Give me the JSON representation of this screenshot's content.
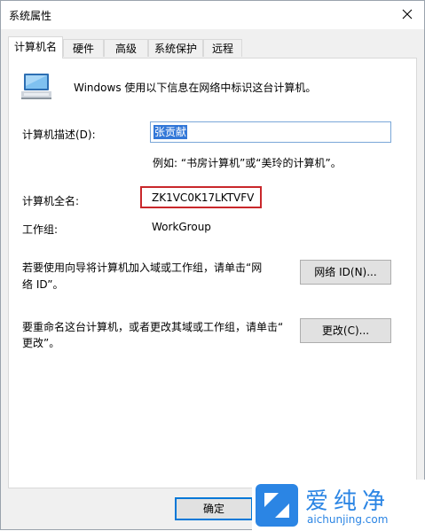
{
  "window": {
    "title": "系统属性"
  },
  "tabs": [
    {
      "label": "计算机名",
      "active": true
    },
    {
      "label": "硬件",
      "active": false
    },
    {
      "label": "高级",
      "active": false
    },
    {
      "label": "系统保护",
      "active": false
    },
    {
      "label": "远程",
      "active": false
    }
  ],
  "main": {
    "info_text": "Windows 使用以下信息在网络中标识这台计算机。",
    "description": {
      "label": "计算机描述(D):",
      "value": "张贡献",
      "hint": "例如: “书房计算机”或“美玲的计算机”。"
    },
    "full_name": {
      "label": "计算机全名:",
      "value": "ZK1VC0K17LKTVFV"
    },
    "workgroup": {
      "label": "工作组:",
      "value": "WorkGroup"
    },
    "network_id": {
      "text_line1": "若要使用向导将计算机加入域或工作组，请单击“网",
      "text_line2": "络 ID”。",
      "button": "网络 ID(N)..."
    },
    "rename": {
      "text_line1": "要重命名这台计算机，或者更改其域或工作组，请单击“",
      "text_line2": "更改”。",
      "button": "更改(C)..."
    }
  },
  "footer": {
    "ok": "确定"
  },
  "watermark": {
    "brand": "爱纯净",
    "domain": "aichunjing.com"
  },
  "colors": {
    "accent": "#0078d7",
    "highlight": "#c9272b",
    "selection": "#3378d8",
    "brand": "#2b85e4"
  }
}
